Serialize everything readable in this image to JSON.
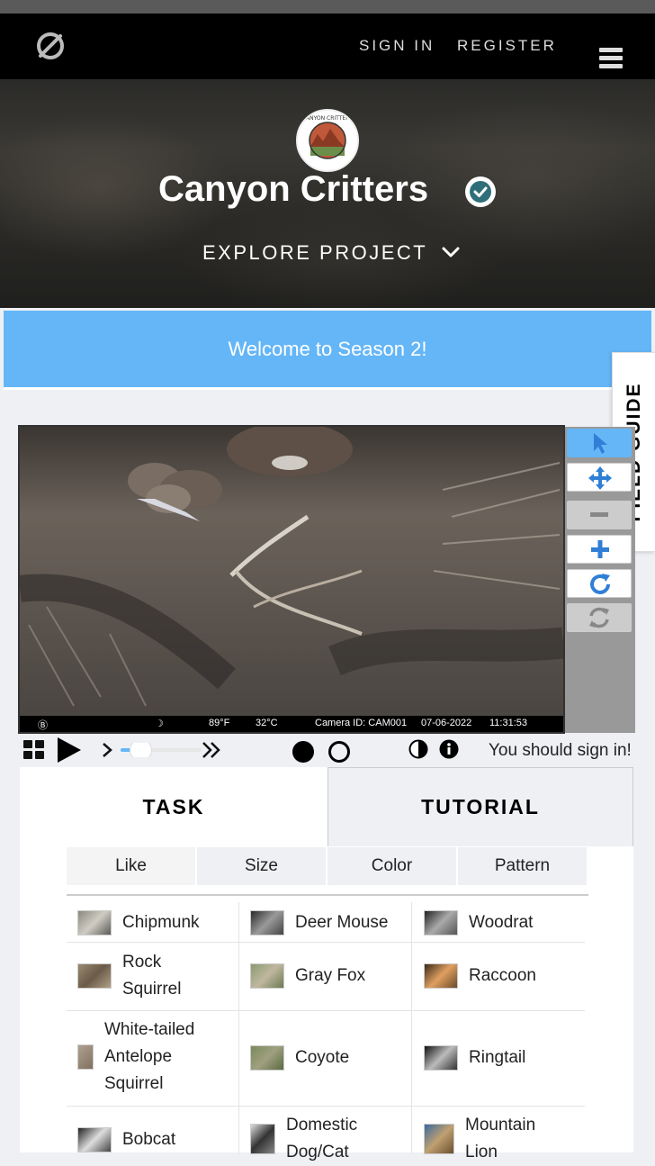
{
  "nav": {
    "sign_in": "SIGN IN",
    "register": "REGISTER"
  },
  "hero": {
    "title": "Canyon Critters",
    "explore": "EXPLORE PROJECT",
    "avatar_text": "CANYON CRITTERS"
  },
  "banner": {
    "text": "Welcome to Season 2!"
  },
  "field_guide": {
    "label": "FIELD GUIDE"
  },
  "subject": {
    "strip": {
      "temp_f": "89°F",
      "temp_c": "32°C",
      "camera": "Camera ID: CAM001",
      "date": "07-06-2022",
      "time": "11:31:53"
    }
  },
  "controls": {
    "signin_message": "You should sign in!",
    "playback_speed": 0.25
  },
  "tabs": {
    "task": "TASK",
    "tutorial": "TUTORIAL"
  },
  "filters": [
    "Like",
    "Size",
    "Color",
    "Pattern"
  ],
  "species": [
    {
      "name": "Chipmunk",
      "lines": [
        "Chipmunk"
      ]
    },
    {
      "name": "Deer Mouse",
      "lines": [
        "Deer Mouse"
      ]
    },
    {
      "name": "Woodrat",
      "lines": [
        "Woodrat"
      ]
    },
    {
      "name": "Rock Squirrel",
      "lines": [
        "Rock",
        "Squirrel"
      ]
    },
    {
      "name": "Gray Fox",
      "lines": [
        "Gray Fox"
      ]
    },
    {
      "name": "Raccoon",
      "lines": [
        "Raccoon"
      ]
    },
    {
      "name": "White-tailed Antelope Squirrel",
      "lines": [
        "White-tailed",
        "Antelope",
        "Squirrel"
      ]
    },
    {
      "name": "Coyote",
      "lines": [
        "Coyote"
      ]
    },
    {
      "name": "Ringtail",
      "lines": [
        "Ringtail"
      ]
    },
    {
      "name": "Bobcat",
      "lines": [
        "Bobcat"
      ]
    },
    {
      "name": "Domestic Dog/Cat",
      "lines": [
        "Domestic",
        "Dog/Cat"
      ]
    },
    {
      "name": "Mountain Lion",
      "lines": [
        "Mountain",
        "Lion"
      ]
    }
  ],
  "colors": {
    "accent_blue": "#64b6f7",
    "tool_icon_blue": "#2f7fd6",
    "nav_bg": "#000000"
  }
}
